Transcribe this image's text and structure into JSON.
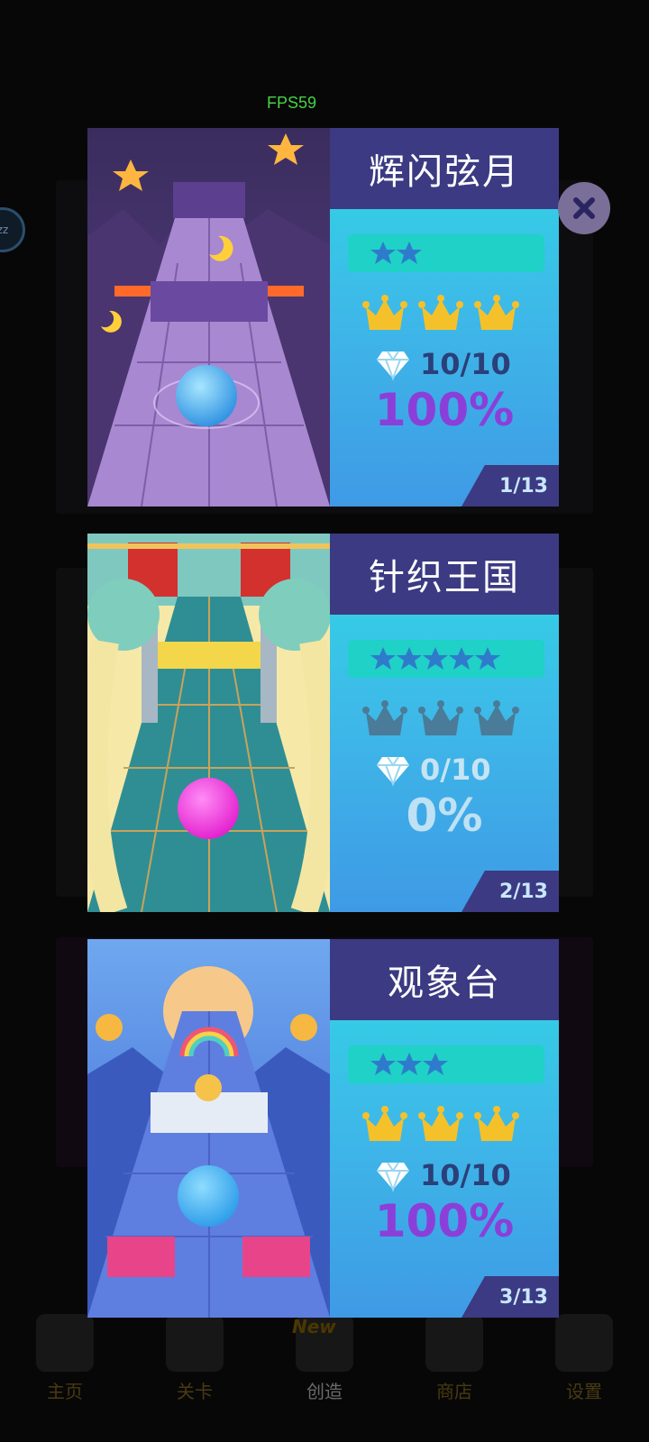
{
  "fps": "FPS59",
  "side_bubble": "zz",
  "levels": [
    {
      "title": "辉闪弦月",
      "stars": 2,
      "crowns_earned": true,
      "gems": "10/10",
      "percent": "100%",
      "page": "1/13"
    },
    {
      "title": "针织王国",
      "stars": 5,
      "crowns_earned": false,
      "gems": "0/10",
      "percent": "0%",
      "page": "2/13"
    },
    {
      "title": "观象台",
      "stars": 3,
      "crowns_earned": true,
      "gems": "10/10",
      "percent": "100%",
      "page": "3/13"
    }
  ],
  "bottom_nav": {
    "new_badge": "New",
    "items": [
      {
        "label": "主页",
        "icon": "home-icon"
      },
      {
        "label": "关卡",
        "icon": "list-icon"
      },
      {
        "label": "创造",
        "icon": "bulb-icon"
      },
      {
        "label": "商店",
        "icon": "cart-icon"
      },
      {
        "label": "设置",
        "icon": "gear-icon"
      }
    ]
  },
  "colors": {
    "header": "#3b3a82",
    "star": "#2f7bcb",
    "crown_gold": "#f5c12a",
    "crown_dim": "#4a7b98",
    "percent_done": "#8b3fd9",
    "percent_none": "#bfe1f4",
    "gem_text_done": "#2b3f78",
    "gem_text_none": "#c6e4f4"
  }
}
